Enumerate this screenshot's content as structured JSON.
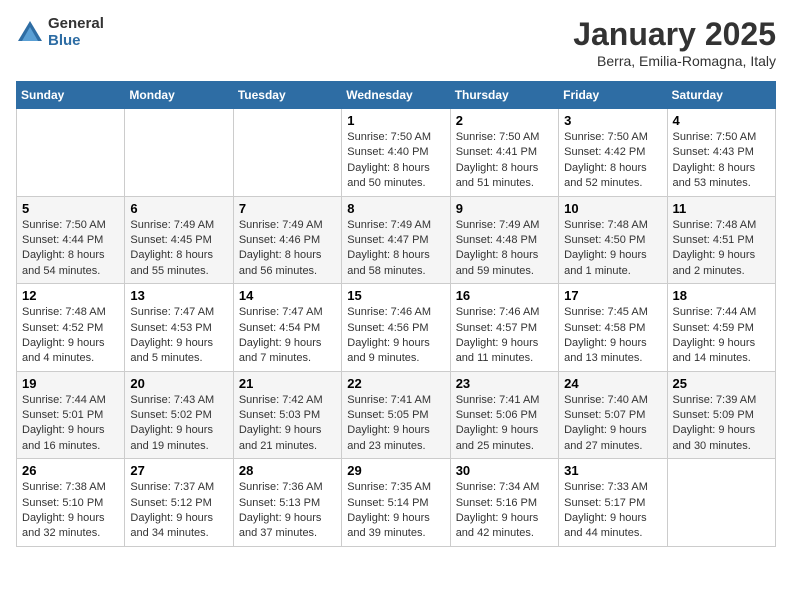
{
  "logo": {
    "general": "General",
    "blue": "Blue"
  },
  "header": {
    "month": "January 2025",
    "location": "Berra, Emilia-Romagna, Italy"
  },
  "weekdays": [
    "Sunday",
    "Monday",
    "Tuesday",
    "Wednesday",
    "Thursday",
    "Friday",
    "Saturday"
  ],
  "weeks": [
    [
      {
        "day": "",
        "info": ""
      },
      {
        "day": "",
        "info": ""
      },
      {
        "day": "",
        "info": ""
      },
      {
        "day": "1",
        "sunrise": "Sunrise: 7:50 AM",
        "sunset": "Sunset: 4:40 PM",
        "daylight": "Daylight: 8 hours and 50 minutes."
      },
      {
        "day": "2",
        "sunrise": "Sunrise: 7:50 AM",
        "sunset": "Sunset: 4:41 PM",
        "daylight": "Daylight: 8 hours and 51 minutes."
      },
      {
        "day": "3",
        "sunrise": "Sunrise: 7:50 AM",
        "sunset": "Sunset: 4:42 PM",
        "daylight": "Daylight: 8 hours and 52 minutes."
      },
      {
        "day": "4",
        "sunrise": "Sunrise: 7:50 AM",
        "sunset": "Sunset: 4:43 PM",
        "daylight": "Daylight: 8 hours and 53 minutes."
      }
    ],
    [
      {
        "day": "5",
        "sunrise": "Sunrise: 7:50 AM",
        "sunset": "Sunset: 4:44 PM",
        "daylight": "Daylight: 8 hours and 54 minutes."
      },
      {
        "day": "6",
        "sunrise": "Sunrise: 7:49 AM",
        "sunset": "Sunset: 4:45 PM",
        "daylight": "Daylight: 8 hours and 55 minutes."
      },
      {
        "day": "7",
        "sunrise": "Sunrise: 7:49 AM",
        "sunset": "Sunset: 4:46 PM",
        "daylight": "Daylight: 8 hours and 56 minutes."
      },
      {
        "day": "8",
        "sunrise": "Sunrise: 7:49 AM",
        "sunset": "Sunset: 4:47 PM",
        "daylight": "Daylight: 8 hours and 58 minutes."
      },
      {
        "day": "9",
        "sunrise": "Sunrise: 7:49 AM",
        "sunset": "Sunset: 4:48 PM",
        "daylight": "Daylight: 8 hours and 59 minutes."
      },
      {
        "day": "10",
        "sunrise": "Sunrise: 7:48 AM",
        "sunset": "Sunset: 4:50 PM",
        "daylight": "Daylight: 9 hours and 1 minute."
      },
      {
        "day": "11",
        "sunrise": "Sunrise: 7:48 AM",
        "sunset": "Sunset: 4:51 PM",
        "daylight": "Daylight: 9 hours and 2 minutes."
      }
    ],
    [
      {
        "day": "12",
        "sunrise": "Sunrise: 7:48 AM",
        "sunset": "Sunset: 4:52 PM",
        "daylight": "Daylight: 9 hours and 4 minutes."
      },
      {
        "day": "13",
        "sunrise": "Sunrise: 7:47 AM",
        "sunset": "Sunset: 4:53 PM",
        "daylight": "Daylight: 9 hours and 5 minutes."
      },
      {
        "day": "14",
        "sunrise": "Sunrise: 7:47 AM",
        "sunset": "Sunset: 4:54 PM",
        "daylight": "Daylight: 9 hours and 7 minutes."
      },
      {
        "day": "15",
        "sunrise": "Sunrise: 7:46 AM",
        "sunset": "Sunset: 4:56 PM",
        "daylight": "Daylight: 9 hours and 9 minutes."
      },
      {
        "day": "16",
        "sunrise": "Sunrise: 7:46 AM",
        "sunset": "Sunset: 4:57 PM",
        "daylight": "Daylight: 9 hours and 11 minutes."
      },
      {
        "day": "17",
        "sunrise": "Sunrise: 7:45 AM",
        "sunset": "Sunset: 4:58 PM",
        "daylight": "Daylight: 9 hours and 13 minutes."
      },
      {
        "day": "18",
        "sunrise": "Sunrise: 7:44 AM",
        "sunset": "Sunset: 4:59 PM",
        "daylight": "Daylight: 9 hours and 14 minutes."
      }
    ],
    [
      {
        "day": "19",
        "sunrise": "Sunrise: 7:44 AM",
        "sunset": "Sunset: 5:01 PM",
        "daylight": "Daylight: 9 hours and 16 minutes."
      },
      {
        "day": "20",
        "sunrise": "Sunrise: 7:43 AM",
        "sunset": "Sunset: 5:02 PM",
        "daylight": "Daylight: 9 hours and 19 minutes."
      },
      {
        "day": "21",
        "sunrise": "Sunrise: 7:42 AM",
        "sunset": "Sunset: 5:03 PM",
        "daylight": "Daylight: 9 hours and 21 minutes."
      },
      {
        "day": "22",
        "sunrise": "Sunrise: 7:41 AM",
        "sunset": "Sunset: 5:05 PM",
        "daylight": "Daylight: 9 hours and 23 minutes."
      },
      {
        "day": "23",
        "sunrise": "Sunrise: 7:41 AM",
        "sunset": "Sunset: 5:06 PM",
        "daylight": "Daylight: 9 hours and 25 minutes."
      },
      {
        "day": "24",
        "sunrise": "Sunrise: 7:40 AM",
        "sunset": "Sunset: 5:07 PM",
        "daylight": "Daylight: 9 hours and 27 minutes."
      },
      {
        "day": "25",
        "sunrise": "Sunrise: 7:39 AM",
        "sunset": "Sunset: 5:09 PM",
        "daylight": "Daylight: 9 hours and 30 minutes."
      }
    ],
    [
      {
        "day": "26",
        "sunrise": "Sunrise: 7:38 AM",
        "sunset": "Sunset: 5:10 PM",
        "daylight": "Daylight: 9 hours and 32 minutes."
      },
      {
        "day": "27",
        "sunrise": "Sunrise: 7:37 AM",
        "sunset": "Sunset: 5:12 PM",
        "daylight": "Daylight: 9 hours and 34 minutes."
      },
      {
        "day": "28",
        "sunrise": "Sunrise: 7:36 AM",
        "sunset": "Sunset: 5:13 PM",
        "daylight": "Daylight: 9 hours and 37 minutes."
      },
      {
        "day": "29",
        "sunrise": "Sunrise: 7:35 AM",
        "sunset": "Sunset: 5:14 PM",
        "daylight": "Daylight: 9 hours and 39 minutes."
      },
      {
        "day": "30",
        "sunrise": "Sunrise: 7:34 AM",
        "sunset": "Sunset: 5:16 PM",
        "daylight": "Daylight: 9 hours and 42 minutes."
      },
      {
        "day": "31",
        "sunrise": "Sunrise: 7:33 AM",
        "sunset": "Sunset: 5:17 PM",
        "daylight": "Daylight: 9 hours and 44 minutes."
      },
      {
        "day": "",
        "info": ""
      }
    ]
  ]
}
